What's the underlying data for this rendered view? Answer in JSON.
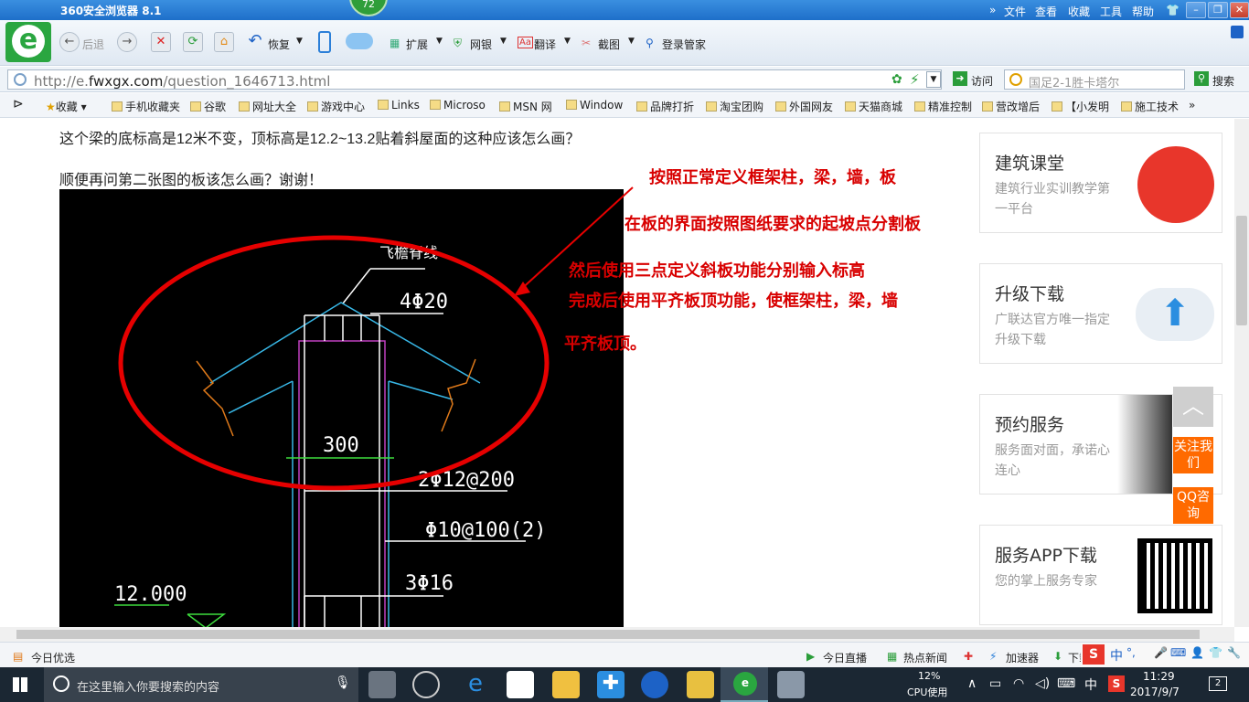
{
  "window": {
    "title": "360安全浏览器 8.1",
    "badge": "72",
    "menu": [
      "文件",
      "查看",
      "收藏",
      "工具",
      "帮助"
    ]
  },
  "toolbar": {
    "back": "后退",
    "restore": "恢复",
    "extend": "扩展",
    "netbank": "网银",
    "translate": "翻译",
    "screenshot": "截图",
    "login_manager": "登录管家"
  },
  "address": {
    "url_prefix": "http://e.",
    "url_domain": "fwxgx.com",
    "url_path": "/question_1646713.html",
    "go_label": "访问",
    "search_placeholder": "国足2-1胜卡塔尔",
    "search_button": "搜索"
  },
  "bookmarks": [
    "收藏",
    "手机收藏夹",
    "谷歌",
    "网址大全",
    "游戏中心",
    "Links",
    "Microso",
    "MSN 网",
    "Window",
    "品牌打折",
    "淘宝团购",
    "外国网友",
    "天猫商城",
    "精准控制",
    "营改增后",
    "【小发明",
    "施工技术"
  ],
  "question": {
    "line1": "这个梁的底标高是12米不变，顶标高是12.2~13.2贴着斜屋面的这种应该怎么画？",
    "line2": "顺便再问第二张图的板该怎么画？谢谢！"
  },
  "drawing": {
    "label_ridge": "飞檐脊线",
    "label_4phi20": "4Φ20",
    "label_300": "300",
    "label_2phi12": "2Φ12@200",
    "label_phi10": "Φ10@100(2)",
    "label_3phi16": "3Φ16",
    "label_elev": "12.000"
  },
  "annotations": {
    "a1": "按照正常定义框架柱，梁，墙，板",
    "a2": "在板的界面按照图纸要求的起坡点分割板",
    "a3": "然后使用三点定义斜板功能分别输入标高",
    "a4": "完成后使用平齐板顶功能，使框架柱，梁，墙",
    "a5": "平齐板顶。"
  },
  "sidebar": {
    "cards": [
      {
        "title": "建筑课堂",
        "sub": "建筑行业实训教学第一平台"
      },
      {
        "title": "升级下载",
        "sub": "广联达官方唯一指定升级下载"
      },
      {
        "title": "预约服务",
        "sub": "服务面对面，承诺心连心"
      },
      {
        "title": "服务APP下载",
        "sub": "您的掌上服务专家"
      }
    ],
    "follow": "关注我们",
    "qq": "QQ咨询"
  },
  "statusbar": {
    "left": "今日优选",
    "live": "今日直播",
    "news": "热点新闻",
    "accel": "加速器",
    "download": "下载",
    "ime": "中"
  },
  "taskbar": {
    "search_placeholder": "在这里输入你要搜索的内容",
    "cpu_percent": "12%",
    "cpu_label": "CPU使用",
    "ime": "中",
    "time": "11:29",
    "date": "2017/9/7",
    "notifications": "2"
  }
}
